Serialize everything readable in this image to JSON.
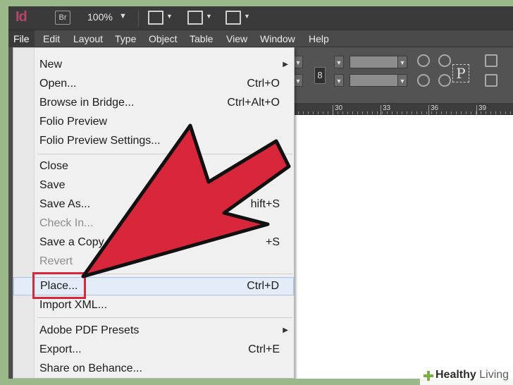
{
  "app": {
    "logo": "Id",
    "bridge_button": "Br",
    "zoom": "100%"
  },
  "menubar": [
    "File",
    "Edit",
    "Layout",
    "Type",
    "Object",
    "Table",
    "View",
    "Window",
    "Help"
  ],
  "ruler": [
    "30",
    "33",
    "36",
    "39"
  ],
  "control": {
    "frame_icon": "P"
  },
  "file_menu": {
    "items": [
      {
        "label": "New",
        "shortcut": "",
        "submenu": true,
        "disabled": false
      },
      {
        "label": "Open...",
        "shortcut": "Ctrl+O",
        "submenu": false,
        "disabled": false
      },
      {
        "label": "Browse in Bridge...",
        "shortcut": "Ctrl+Alt+O",
        "submenu": false,
        "disabled": false
      },
      {
        "label": "Folio Preview",
        "shortcut": "",
        "submenu": false,
        "disabled": false
      },
      {
        "label": "Folio Preview Settings...",
        "shortcut": "",
        "submenu": false,
        "disabled": false
      },
      {
        "label": "Close",
        "shortcut": "",
        "submenu": false,
        "disabled": false
      },
      {
        "label": "Save",
        "shortcut": "",
        "submenu": false,
        "disabled": false
      },
      {
        "label": "Save As...",
        "shortcut": "hift+S",
        "submenu": false,
        "disabled": false
      },
      {
        "label": "Check In...",
        "shortcut": "",
        "submenu": false,
        "disabled": true
      },
      {
        "label": "Save a Copy...",
        "shortcut": "+S",
        "submenu": false,
        "disabled": false
      },
      {
        "label": "Revert",
        "shortcut": "",
        "submenu": false,
        "disabled": true
      },
      {
        "label": "Place...",
        "shortcut": "Ctrl+D",
        "submenu": false,
        "disabled": false,
        "highlighted": true
      },
      {
        "label": "Import XML...",
        "shortcut": "",
        "submenu": false,
        "disabled": false
      },
      {
        "label": "Adobe PDF Presets",
        "shortcut": "",
        "submenu": true,
        "disabled": false
      },
      {
        "label": "Export...",
        "shortcut": "Ctrl+E",
        "submenu": false,
        "disabled": false
      },
      {
        "label": "Share on Behance...",
        "shortcut": "",
        "submenu": false,
        "disabled": false
      }
    ]
  },
  "watermark": {
    "brand_a": "Healthy",
    "brand_b": " Living"
  },
  "colors": {
    "annotation_red": "#d8263a",
    "app_accent": "#b5476b"
  }
}
